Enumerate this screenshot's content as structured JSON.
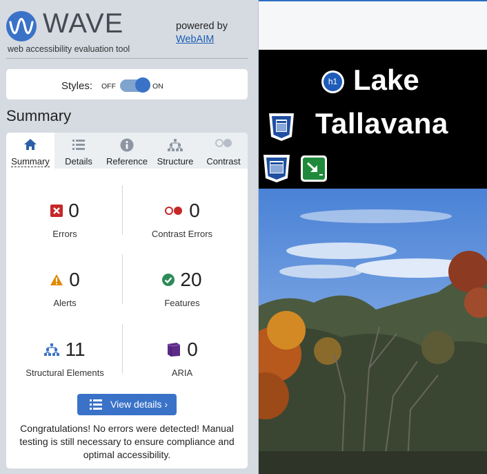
{
  "sidebar": {
    "brand": {
      "name": "WAVE",
      "tagline": "web accessibility evaluation tool",
      "powered_by": "powered by",
      "webaim": "WebAIM"
    },
    "styles": {
      "label": "Styles:",
      "off": "OFF",
      "on": "ON",
      "state": "on"
    },
    "summary_title": "Summary",
    "tabs": [
      {
        "label": "Summary",
        "icon": "home-icon",
        "active": true
      },
      {
        "label": "Details",
        "icon": "list-icon"
      },
      {
        "label": "Reference",
        "icon": "info-icon"
      },
      {
        "label": "Structure",
        "icon": "structure-icon"
      },
      {
        "label": "Contrast",
        "icon": "contrast-icon"
      }
    ],
    "stats": [
      {
        "count": "0",
        "label": "Errors",
        "icon": "error-icon"
      },
      {
        "count": "0",
        "label": "Contrast Errors",
        "icon": "contrast-error-icon"
      },
      {
        "count": "0",
        "label": "Alerts",
        "icon": "alert-icon"
      },
      {
        "count": "20",
        "label": "Features",
        "icon": "feature-icon"
      },
      {
        "count": "11",
        "label": "Structural Elements",
        "icon": "structural-icon"
      },
      {
        "count": "0",
        "label": "ARIA",
        "icon": "aria-icon"
      }
    ],
    "view_details": "View details ›",
    "congrats": "Congratulations! No errors were detected! Manual testing is still necessary to ensure compliance and optimal accessibility."
  },
  "page": {
    "heading_line1": "Lake",
    "heading_line2": "Tallavana",
    "h1_badge": "h1"
  },
  "colors": {
    "accent": "#3a72c8",
    "error": "#c62828",
    "alert": "#e08a00",
    "feature": "#2e8b57",
    "aria": "#5b2a86"
  }
}
